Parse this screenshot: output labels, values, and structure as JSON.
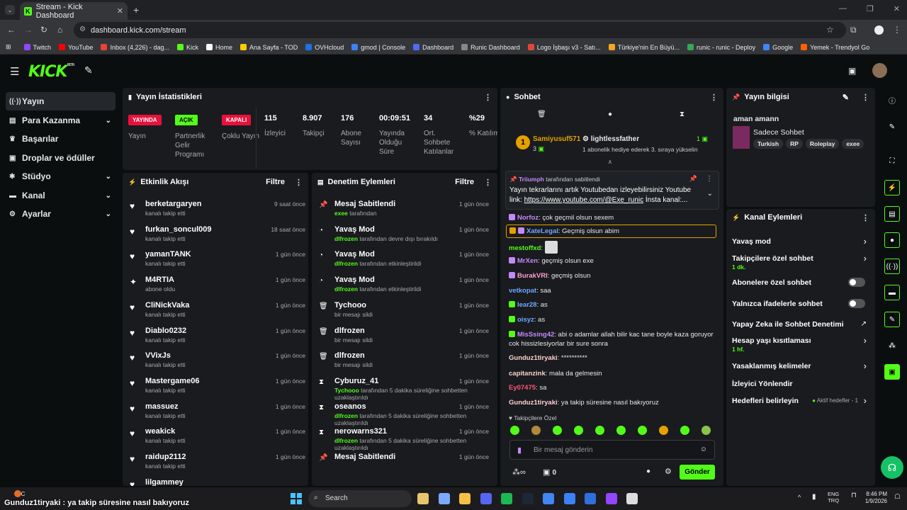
{
  "browser": {
    "tab_title": "Stream - Kick Dashboard",
    "url": "dashboard.kick.com/stream",
    "bookmarks": [
      "Twitch",
      "YouTube",
      "Inbox (4,226) - dag...",
      "Kick",
      "Home",
      "Ana Sayfa - TOD",
      "OVHcloud",
      "gmod | Console",
      "Dashboard",
      "Runic Dashboard",
      "Logo İşbaşı v3 - Satı...",
      "Türkiye'nin En Büyü...",
      "runic - runic - Deploy",
      "Google",
      "Yemek - Trendyol Go"
    ]
  },
  "logo": "KICK",
  "logo_beta": "BETA",
  "sidebar": [
    {
      "label": "Yayın",
      "icon": "((·))"
    },
    {
      "label": "Para Kazanma",
      "icon": "▤",
      "chev": "⌄"
    },
    {
      "label": "Başarılar",
      "icon": "♛"
    },
    {
      "label": "Droplar ve ödüller",
      "icon": "▣"
    },
    {
      "label": "Stüdyo",
      "icon": "✱",
      "chev": "⌄"
    },
    {
      "label": "Kanal",
      "icon": "▬",
      "chev": "⌄"
    },
    {
      "label": "Ayarlar",
      "icon": "⚙",
      "chev": "⌄"
    }
  ],
  "stats": {
    "title": "Yayın İstatistikleri",
    "badges": [
      {
        "text": "YAYINDA",
        "label": "Yayın"
      },
      {
        "text": "AÇIK",
        "label": "Partnerlik Gelir Programı"
      },
      {
        "text": "KAPALI",
        "label": "Çoklu Yayın"
      }
    ],
    "metrics": [
      {
        "value": "115",
        "label": "İzleyici"
      },
      {
        "value": "8.907",
        "label": "Takipçi"
      },
      {
        "value": "176",
        "label": "Abone Sayısı"
      },
      {
        "value": "00:09:51",
        "label": "Yayında Olduğu Süre"
      },
      {
        "value": "34",
        "label": "Ort. Sohbete Katılanlar"
      },
      {
        "value": "%29",
        "label": "% Katılım"
      }
    ]
  },
  "activity": {
    "title": "Etkinlik Akışı",
    "filter": "Filtre",
    "items": [
      {
        "name": "berketargaryen",
        "sub": "kanalı takip etti",
        "time": "9 saat önce",
        "icon": "♥"
      },
      {
        "name": "furkan_soncul009",
        "sub": "kanalı takip etti",
        "time": "18 saat önce",
        "icon": "♥"
      },
      {
        "name": "yamanTANK",
        "sub": "kanalı takip etti",
        "time": "1 gün önce",
        "icon": "♥"
      },
      {
        "name": "M4RTIA",
        "sub": "abone oldu",
        "time": "1 gün önce",
        "icon": "✦"
      },
      {
        "name": "CliNickVaka",
        "sub": "kanalı takip etti",
        "time": "1 gün önce",
        "icon": "♥"
      },
      {
        "name": "Diablo0232",
        "sub": "kanalı takip etti",
        "time": "1 gün önce",
        "icon": "♥"
      },
      {
        "name": "VVixJs",
        "sub": "kanalı takip etti",
        "time": "1 gün önce",
        "icon": "♥"
      },
      {
        "name": "Mastergame06",
        "sub": "kanalı takip etti",
        "time": "1 gün önce",
        "icon": "♥"
      },
      {
        "name": "massuez",
        "sub": "kanalı takip etti",
        "time": "1 gün önce",
        "icon": "♥"
      },
      {
        "name": "weakick",
        "sub": "kanalı takip etti",
        "time": "1 gün önce",
        "icon": "♥"
      },
      {
        "name": "raidup2112",
        "sub": "kanalı takip etti",
        "time": "1 gün önce",
        "icon": "♥"
      },
      {
        "name": "lilgammey",
        "sub": "",
        "time": "",
        "icon": "♥"
      }
    ]
  },
  "moderation": {
    "title": "Denetim Eylemleri",
    "filter": "Filtre",
    "items": [
      {
        "name": "Mesaj Sabitlendi",
        "actor": "exee",
        "sub": " tarafından",
        "time": "1 gün önce",
        "icon": "📌"
      },
      {
        "name": "Yavaş Mod",
        "actor": "dlfrozen",
        "sub": " tarafından devre dışı bırakıldı",
        "time": "1 gün önce",
        "icon": "◔"
      },
      {
        "name": "Yavaş Mod",
        "actor": "dlfrozen",
        "sub": " tarafından etkinleştirildi",
        "time": "1 gün önce",
        "icon": "◔"
      },
      {
        "name": "Yavaş Mod",
        "actor": "dlfrozen",
        "sub": " tarafından etkinleştirildi",
        "time": "1 gün önce",
        "icon": "◔"
      },
      {
        "name": "Tychooo",
        "actor": "",
        "sub": "bir mesajı sildi",
        "time": "1 gün önce",
        "icon": "🗑"
      },
      {
        "name": "dlfrozen",
        "actor": "",
        "sub": "bir mesajı sildi",
        "time": "1 gün önce",
        "icon": "🗑"
      },
      {
        "name": "dlfrozen",
        "actor": "",
        "sub": "bir mesajı sildi",
        "time": "1 gün önce",
        "icon": "🗑"
      },
      {
        "name": "Cyburuz_41",
        "actor": "Tychooo",
        "sub": " tarafından 5 dakika süreliğine sohbetten uzaklaştırıldı",
        "time": "1 gün önce",
        "icon": "⧗"
      },
      {
        "name": "oseanos",
        "actor": "dlfrozen",
        "sub": " tarafından 5 dakika süreliğine sohbetten uzaklaştırıldı",
        "time": "1 gün önce",
        "icon": "⧗"
      },
      {
        "name": "nerowarns321",
        "actor": "dlfrozen",
        "sub": " tarafından 5 dakika süreliğine sohbetten uzaklaştırıldı",
        "time": "1 gün önce",
        "icon": "⧗"
      },
      {
        "name": "Mesaj Sabitlendi",
        "actor": "",
        "sub": "",
        "time": "1 gün önce",
        "icon": "📌"
      }
    ]
  },
  "chat": {
    "title": "Sohbet",
    "top_gifter": "Samiyusuf571",
    "top_count": "3",
    "gift_user": "lightlessfather",
    "gift_count": "1",
    "gift_text": "1 abonelik hediye ederek 3. sıraya yükselin",
    "pinned_by": "Triiumph",
    "pinned_suffix": " tarafından sabitlendi",
    "pinned_text": "Yayın tekrarlarını artık Youtubedan izleyebilirsiniz Youtube link: ",
    "pinned_link": "https://www.youtube.com/@Exe_runic",
    "pinned_tail": " İnsta kanal:...",
    "messages": [
      {
        "user": "Norfoz",
        "color": "#c58af9",
        "text": ": çok geçmil olsun sexem"
      },
      {
        "user": "XateLegal",
        "color": "#6fa8ff",
        "text": ": Geçmiş olsun abim"
      },
      {
        "user": "mestoffxd",
        "color": "#53fc18",
        "text": ": "
      },
      {
        "user": "MrXen",
        "color": "#c58af9",
        "text": ": geçmiş olsun exe"
      },
      {
        "user": "BurakVRI",
        "color": "#ff9fd0",
        "text": ": geçmiş olsun"
      },
      {
        "user": "vetkopat",
        "color": "#6fa8ff",
        "text": ": saa"
      },
      {
        "user": "lear28",
        "color": "#6fa8ff",
        "text": ": as"
      },
      {
        "user": "oisyz",
        "color": "#6fa8ff",
        "text": ": as"
      },
      {
        "user": "MisSsing42",
        "color": "#c58af9",
        "text": ": abi o adamlar allah bilir kac tane boyle kaza goruyor cok hissizlesiyorlar bir sure sonra"
      },
      {
        "user": "Gunduz1tiryaki",
        "color": "#ffd0d0",
        "text": ": **********"
      },
      {
        "user": "capitanzink",
        "color": "#ffd0d0",
        "text": ": mala da gelmesin"
      },
      {
        "user": "Ey07475",
        "color": "#ff5577",
        "text": ": sa"
      },
      {
        "user": "Gunduz1tiryaki",
        "color": "#ffd0d0",
        "text": ": ya takip süresine nasıl bakıyoruz"
      }
    ],
    "followers_only": "Takipçilere Özel",
    "placeholder": "Bir mesaj gönderin",
    "send": "Gönder",
    "points": "0"
  },
  "stream_info": {
    "title": "Yayın bilgisi",
    "stream_title": "aman amann",
    "category": "Sadece Sohbet",
    "tags": [
      "Turkish",
      "RP",
      "Roleplay",
      "exee"
    ]
  },
  "channel_actions": {
    "title": "Kanal Eylemleri",
    "items": [
      {
        "label": "Yavaş mod",
        "type": "arrow"
      },
      {
        "label": "Takipçilere özel sohbet",
        "sub": "1 dk.",
        "type": "arrow"
      },
      {
        "label": "Abonelere özel sohbet",
        "type": "toggle"
      },
      {
        "label": "Yalnızca ifadelerle sohbet",
        "type": "toggle"
      },
      {
        "label": "Yapay Zeka ile Sohbet Denetimi",
        "type": "ext"
      },
      {
        "label": "Hesap yaşı kısıtlaması",
        "sub": "1 hf.",
        "type": "arrow"
      },
      {
        "label": "Yasaklanmış kelimeler",
        "type": "arrow"
      },
      {
        "label": "İzleyici Yönlendir",
        "type": "none"
      },
      {
        "label": "Hedefleri belirleyin",
        "type": "goal",
        "goal": "Aktif hedefler - 1"
      }
    ]
  },
  "taskbar": {
    "temp": "4°C",
    "search": "Search",
    "lang1": "ENG",
    "lang2": "TRQ",
    "time": "8:46 PM",
    "date": "1/9/2026"
  },
  "overlay_text": "Gunduz1tiryaki : ya takip süresine nasıl bakıyoruz",
  "colors": {
    "accent": "#53fc18",
    "panel": "#191b1f",
    "bg": "#0b0e0f",
    "live": "#e9113c"
  }
}
